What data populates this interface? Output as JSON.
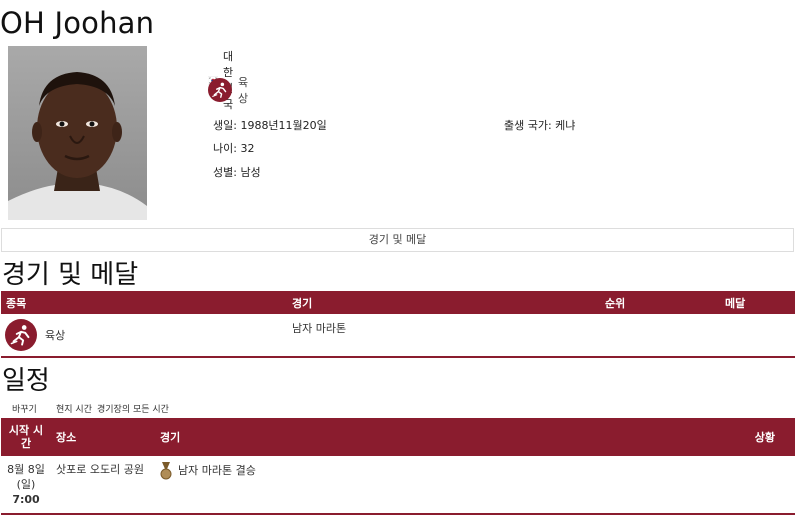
{
  "athlete": {
    "name": "OH Joohan",
    "country": "대한민국",
    "sport": "육상",
    "birth_date_label": "생일: 1988년11월20일",
    "birth_country_label": "출생 국가: 케냐",
    "age_label": "나이: 32",
    "gender_label": "성별: 남성"
  },
  "tabs": {
    "events_medals": "경기 및 메달"
  },
  "events_section": {
    "title": "경기 및 메달",
    "columns": [
      "종목",
      "경기",
      "순위",
      "메달"
    ],
    "rows": [
      {
        "sport": "육상",
        "event": "남자 마라톤",
        "rank": "",
        "medal": ""
      }
    ]
  },
  "schedule_section": {
    "title": "일정",
    "toggle": {
      "switch": "바꾸기",
      "local": "현지 시간",
      "venue": "경기장의 모든 시간"
    },
    "columns": [
      "시작 시간",
      "장소",
      "경기",
      "상황"
    ],
    "rows": [
      {
        "date": "8월 8일 (일)",
        "time": "7:00",
        "venue": "삿포로 오도리 공원",
        "event": "남자 마라톤 결승",
        "status": ""
      }
    ]
  },
  "colors": {
    "accent": "#8a1c2e"
  },
  "icons": {
    "flag": "korea-flag-icon",
    "sport": "athletics-icon",
    "medal": "medal-icon"
  }
}
